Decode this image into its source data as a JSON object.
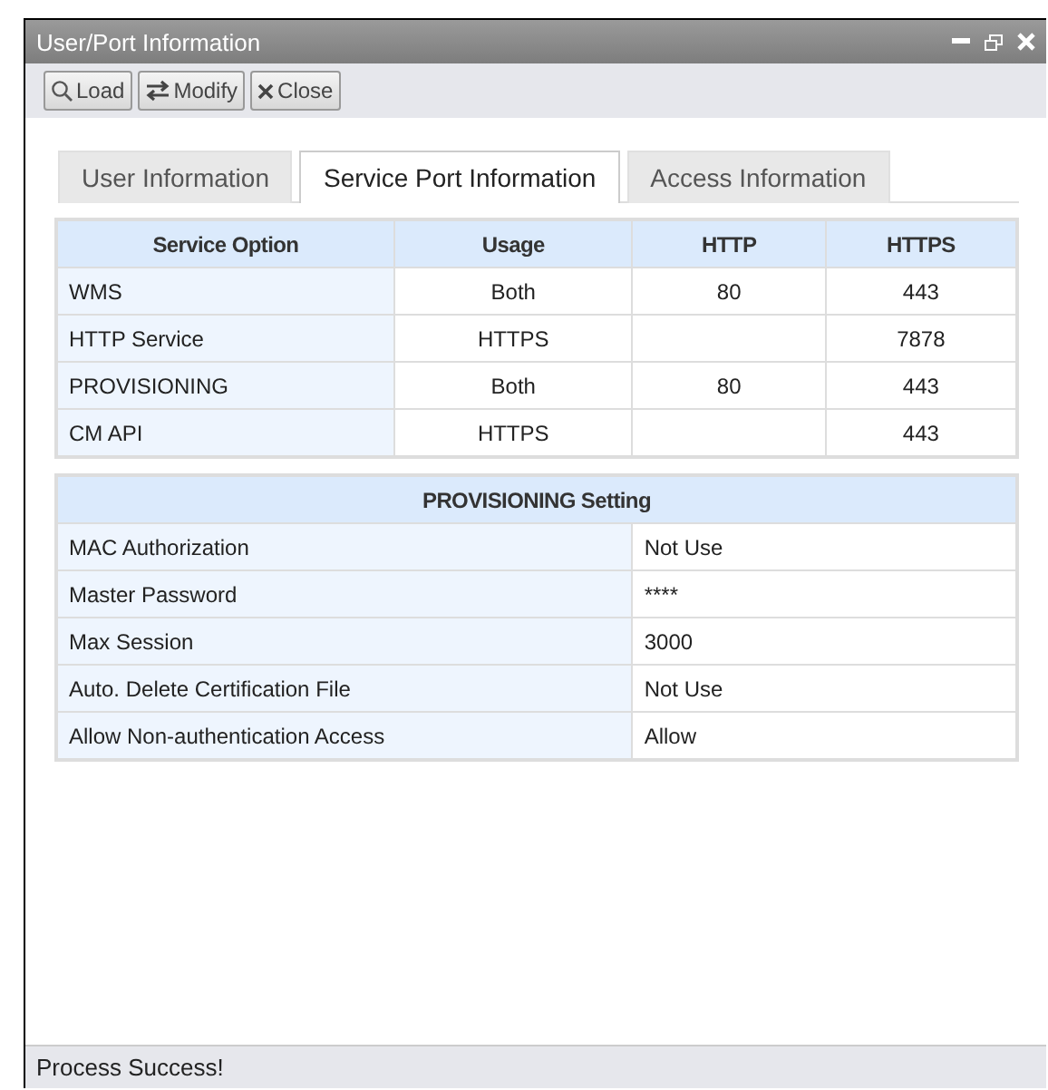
{
  "window": {
    "title": "User/Port Information"
  },
  "toolbar": [
    {
      "label": "Load",
      "kind": "load"
    },
    {
      "label": "Modify",
      "kind": "modify"
    },
    {
      "label": "Close",
      "kind": "close"
    }
  ],
  "tabs": [
    {
      "label": "User Information",
      "selected": false
    },
    {
      "label": "Service Port Information",
      "selected": true
    },
    {
      "label": "Access Information",
      "selected": false
    }
  ],
  "service_table": {
    "columns": [
      "Service Option",
      "Usage",
      "HTTP",
      "HTTPS"
    ],
    "rows": [
      [
        "WMS",
        "Both",
        "80",
        "443"
      ],
      [
        "HTTP Service",
        "HTTPS",
        "",
        "7878"
      ],
      [
        "PROVISIONING",
        "Both",
        "80",
        "443"
      ],
      [
        "CM API",
        "HTTPS",
        "",
        "443"
      ]
    ]
  },
  "provisioning_setting": {
    "title": "PROVISIONING Setting",
    "rows": [
      {
        "label": "MAC Authorization",
        "value": "Not Use"
      },
      {
        "label": "Master Password",
        "value": "****"
      },
      {
        "label": "Max Session",
        "value": "3000"
      },
      {
        "label": "Auto. Delete Certification File",
        "value": "Not Use"
      },
      {
        "label": "Allow Non-authentication Access",
        "value": "Allow"
      }
    ]
  },
  "status_bar": "Process Success!"
}
